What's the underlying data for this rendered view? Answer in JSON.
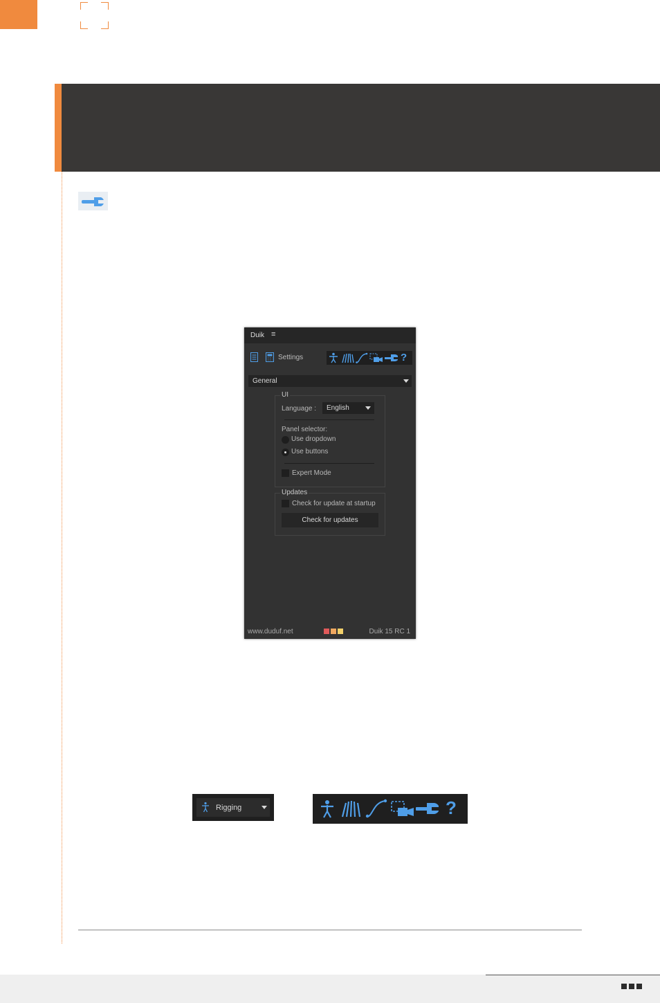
{
  "panel": {
    "title": "Duik",
    "menu_icon": "≡",
    "settings_label": "Settings",
    "section_select": "General",
    "ui_group": {
      "title": "UI",
      "language_label": "Language :",
      "language_value": "English",
      "panel_selector_label": "Panel selector:",
      "option_dropdown": "Use dropdown",
      "option_buttons": "Use buttons",
      "selected_option": "Use buttons",
      "expert_mode": "Expert Mode"
    },
    "updates_group": {
      "title": "Updates",
      "check_startup": "Check for update at startup",
      "check_button": "Check for updates"
    },
    "footer": {
      "url": "www.duduf.net",
      "version": "Duik 15 RC 1",
      "swatches": [
        "#e05a5a",
        "#f0a860",
        "#f2d06a"
      ]
    },
    "tool_icons": [
      "rigging-icon",
      "automation-icon",
      "interpolation-icon",
      "camera-icon",
      "settings-wrench-icon",
      "help-icon"
    ]
  },
  "widgets": {
    "dropdown_example_label": "Rigging",
    "help_glyph": "?"
  },
  "colors": {
    "accent": "#f08a3e",
    "icon_blue": "#4f9ee8",
    "header_bg": "#393736"
  }
}
